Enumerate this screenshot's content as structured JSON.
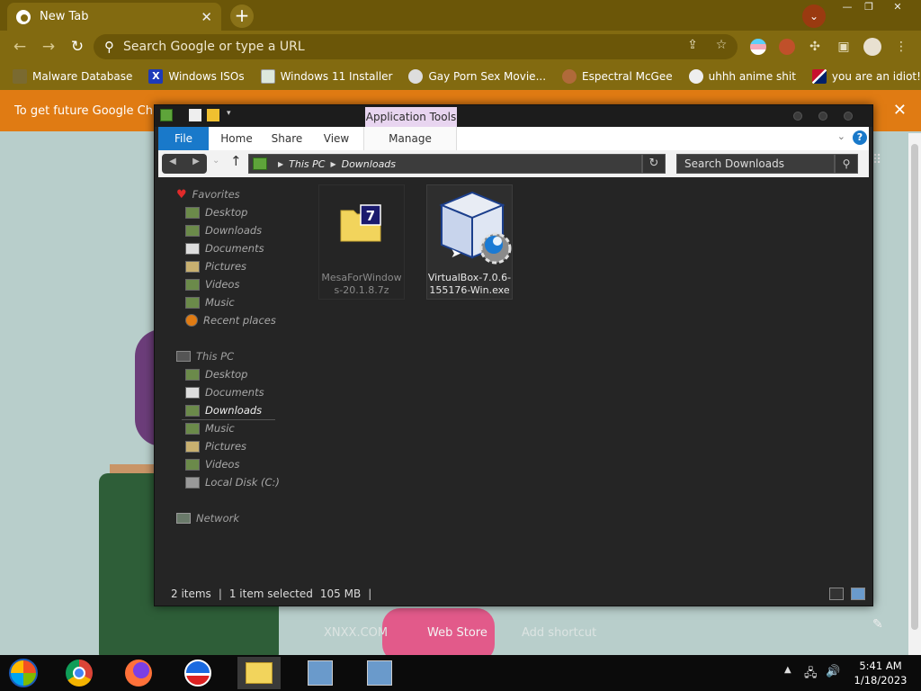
{
  "browser": {
    "tab_title": "New Tab",
    "omnibox_placeholder": "Search Google or type a URL",
    "bookmarks": [
      {
        "label": "Malware Database",
        "icon": "malware-icon"
      },
      {
        "label": "Windows ISOs",
        "icon": "x-icon"
      },
      {
        "label": "Windows 11 Installer",
        "icon": "installer-icon"
      },
      {
        "label": "Gay Porn Sex Movie...",
        "icon": "site-icon"
      },
      {
        "label": "Espectral McGee",
        "icon": "avatar-icon"
      },
      {
        "label": "uhhh anime shit",
        "icon": "anime-icon"
      },
      {
        "label": "you are an idiot!",
        "icon": "flag-icon"
      }
    ],
    "infobar_text": "To get future Google Chrom",
    "shortcuts": [
      "XNXX.COM",
      "Web Store",
      "Add shortcut"
    ]
  },
  "explorer": {
    "ribbon": {
      "context_tab": "Application Tools",
      "tabs": [
        "File",
        "Home",
        "Share",
        "View",
        "Manage"
      ]
    },
    "address": {
      "crumbs": [
        "This PC",
        "Downloads"
      ],
      "search_placeholder": "Search Downloads"
    },
    "nav": {
      "favorites_label": "Favorites",
      "favorites": [
        "Desktop",
        "Downloads",
        "Documents",
        "Pictures",
        "Videos",
        "Music",
        "Recent places"
      ],
      "thispc_label": "This PC",
      "thispc": [
        "Desktop",
        "Documents",
        "Downloads",
        "Music",
        "Pictures",
        "Videos",
        "Local Disk (C:)"
      ],
      "network_label": "Network"
    },
    "files": [
      {
        "name_line1": "MesaForWindow",
        "name_line2": "s-20.1.8.7z",
        "icon": "7z-archive-icon"
      },
      {
        "name_line1": "VirtualBox-7.0.6-",
        "name_line2": "155176-Win.exe",
        "icon": "virtualbox-installer-icon"
      }
    ],
    "status": {
      "items": "2 items",
      "selected": "1 item selected",
      "size": "105 MB"
    }
  },
  "taskbar": {
    "time": "5:41 AM",
    "date": "1/18/2023"
  },
  "colors": {
    "chrome_frame": "#826a10",
    "infobar": "#e07b13",
    "explorer_bg": "#252525",
    "ribbon_file": "#1979ca"
  }
}
